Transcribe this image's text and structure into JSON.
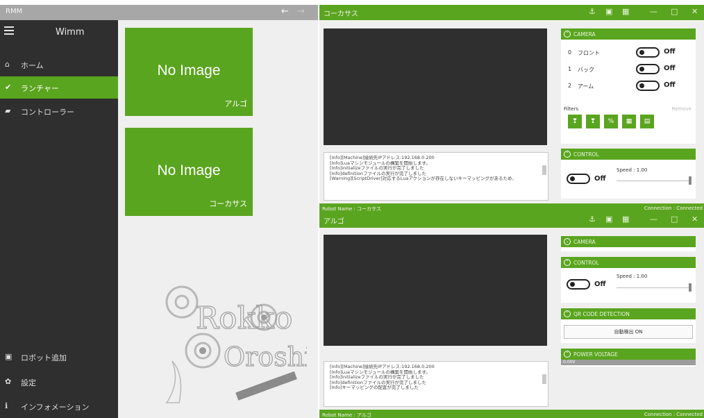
{
  "left_window": {
    "title": "RMM",
    "back_icon": "←",
    "forward_icon": "→",
    "sidebar": {
      "app_title": "Wimm",
      "items": [
        {
          "icon": "⌂",
          "icon_name": "home-icon",
          "label": "ホーム",
          "active": false
        },
        {
          "icon": "✔",
          "icon_name": "check-icon",
          "label": "ランチャー",
          "active": true
        },
        {
          "icon": "▰",
          "icon_name": "gamepad-icon",
          "label": "コントローラー",
          "active": false
        }
      ],
      "bottom_items": [
        {
          "icon": "▣",
          "icon_name": "add-robot-icon",
          "label": "ロボット追加"
        },
        {
          "icon": "✿",
          "icon_name": "gear-icon",
          "label": "設定"
        },
        {
          "icon": "ℹ",
          "icon_name": "info-icon",
          "label": "インフォメーション"
        }
      ]
    },
    "tiles": [
      {
        "image_text": "No Image",
        "name": "アルゴ"
      },
      {
        "image_text": "No Image",
        "name": "コーカサス"
      }
    ],
    "logo": {
      "line1": "Rokko",
      "line2": "Oroshi"
    }
  },
  "robot_windows": [
    {
      "title": "コーカサス",
      "controls": [
        "⚓",
        "▣",
        "▦",
        "—",
        "□",
        "✕"
      ],
      "log_lines": [
        "[Info][Machine]接続先IPアドレス:192.168.0.200",
        "[Info]Luaマシンモジュールの構築を開始します。",
        "[Info]initializeファイルの実行が完了しました",
        "[Info]definitionファイルの実行が完了しました",
        "[Warning][ScriptDriver]対応するLuaアクションが存在しないキーマッピングがあるため、"
      ],
      "status_left": "Robot Name : コーカサス",
      "status_right": "Connection : Connected",
      "camera": {
        "title": "CAMERA",
        "rows": [
          {
            "index": "0",
            "name": "フロント",
            "state": "Off"
          },
          {
            "index": "1",
            "name": "バック",
            "state": "Off"
          },
          {
            "index": "2",
            "name": "アーム",
            "state": "Off"
          }
        ],
        "filters_label": "Filters",
        "filters_remove": "Remove",
        "filter_buttons": [
          "❣",
          "❣",
          "%",
          "▦",
          "▤"
        ]
      },
      "control": {
        "title": "CONTROL",
        "state": "Off",
        "speed": "Speed : 1.00"
      }
    },
    {
      "title": "アルゴ",
      "controls": [
        "⚓",
        "▣",
        "▦",
        "—",
        "□",
        "✕"
      ],
      "log_lines": [
        "[Info][Machine]接続先IPアドレス:192.168.0.200",
        "[Info]Luaマシンモジュールの構築を開始します。",
        "[Info]initializeファイルの実行が完了しました",
        "[Info]definitionファイルの実行が完了しました",
        "[Info]キーマッピングの配置が完了しました"
      ],
      "status_left": "Robot Name : アルゴ",
      "status_right": "Connection : Connected",
      "camera": {
        "title": "CAMERA"
      },
      "control": {
        "title": "CONTROL",
        "state": "Off",
        "speed": "Speed : 1.00"
      },
      "qr": {
        "title": "QR CODE DETECTION",
        "button": "自動検出 ON"
      },
      "power": {
        "title": "POWER VOLTAGE",
        "value": "0.00V"
      }
    }
  ],
  "colors": {
    "accent": "#5aa51f",
    "sidebar": "#2f2f2f",
    "video": "#2f2f2f"
  }
}
